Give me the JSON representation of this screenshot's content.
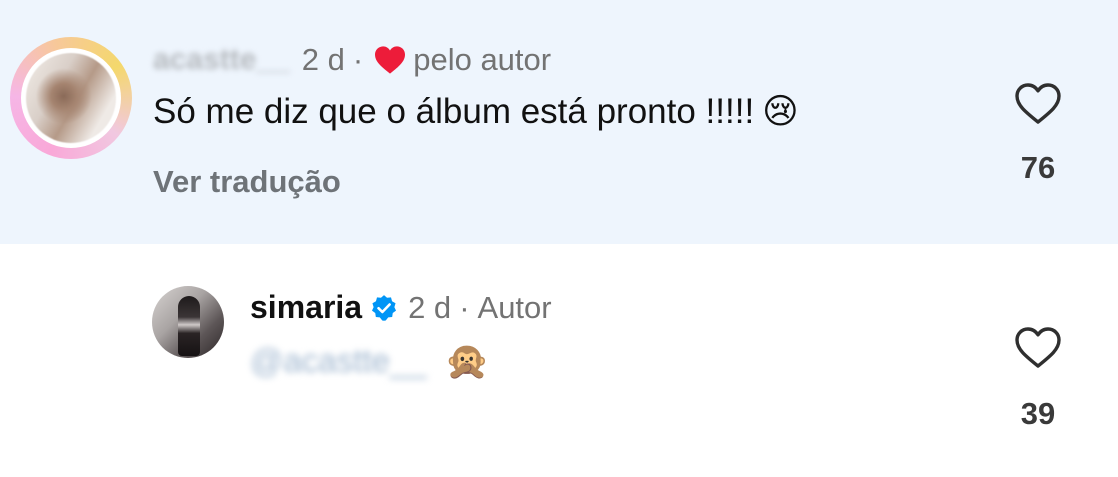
{
  "comments": [
    {
      "username": "acastte__",
      "time": "2 d",
      "separator": "·",
      "liked_by_author_label": "pelo autor",
      "text": "Só me diz que o álbum está pronto !!!!!",
      "emoji": "😢",
      "translate_label": "Ver tradução",
      "like_count": "76",
      "icons": {
        "author_like": "red-heart-icon",
        "like": "heart-outline-icon"
      }
    },
    {
      "username": "simaria",
      "verified": true,
      "time": "2 d",
      "separator": "·",
      "author_label": "Autor",
      "mention": "@acastte__",
      "emoji": "🙊",
      "like_count": "39",
      "icons": {
        "verified": "verified-badge-icon",
        "like": "heart-outline-icon"
      }
    }
  ],
  "colors": {
    "highlight_bg": "#eef5fd",
    "author_heart": "#ed1c3a",
    "verified_blue": "#0095f6",
    "meta_gray": "#737373"
  }
}
